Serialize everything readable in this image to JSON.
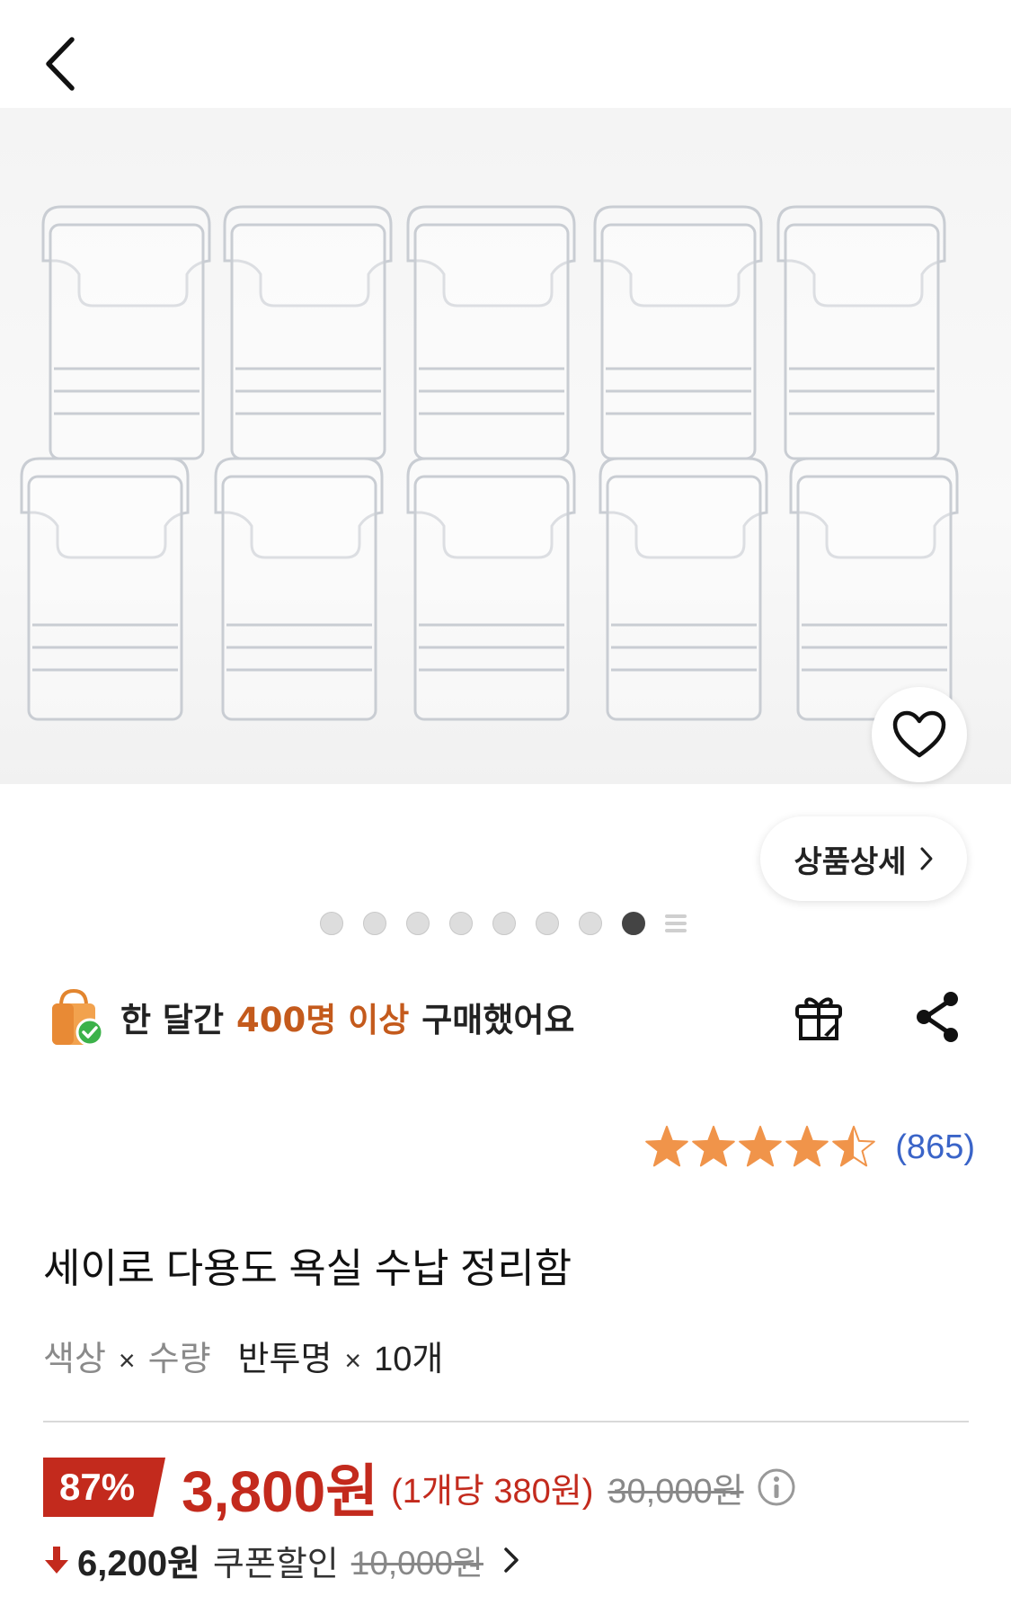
{
  "hero": {
    "detail_label": "상품상세",
    "dots_total": 8,
    "dots_active_index": 7
  },
  "purchase": {
    "prefix": "한 달간",
    "highlight": "400명 이상",
    "suffix": "구매했어요"
  },
  "rating": {
    "stars": 4.5,
    "count": "(865)"
  },
  "product": {
    "title": "세이로 다용도 욕실 수납 정리함",
    "option_label_1": "색상",
    "option_label_2": "수량",
    "option_sep": "×",
    "option_value_1": "반투명",
    "option_value_2": "10개"
  },
  "price": {
    "discount": "87%",
    "final": "3,800원",
    "per_unit": "(1개당 380원)",
    "original": "30,000원"
  },
  "coupon": {
    "amount": "6,200원",
    "label": "쿠폰할인",
    "original": "10,000원"
  },
  "colors": {
    "accent_red": "#c32a1d",
    "highlight_orange": "#c45a1c",
    "star": "#f0944a",
    "link_blue": "#3a64c8"
  }
}
